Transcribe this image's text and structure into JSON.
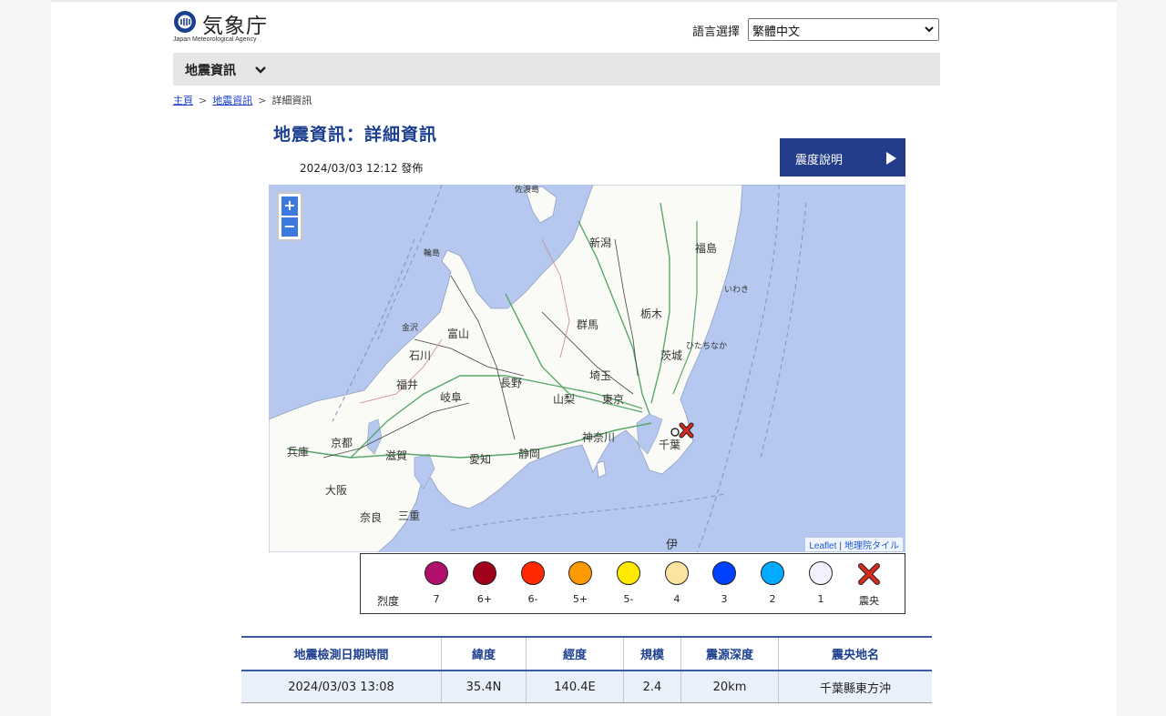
{
  "header": {
    "logo_title": "気象庁",
    "logo_subtitle": "Japan Meteorological Agency",
    "language_label": "語言選擇",
    "language_selected": "繁體中文"
  },
  "nav": {
    "menu_label": "地震資訊"
  },
  "breadcrumb": {
    "home": "主頁",
    "separator": ">",
    "earthquake": "地震資訊",
    "current": "詳細資訊"
  },
  "page": {
    "title": "地震資訊：詳細資訊",
    "issued": "2024/03/03 12:12 發佈",
    "intensity_button": "震度說明"
  },
  "map": {
    "zoom_in": "+",
    "zoom_out": "−",
    "attribution_leaflet": "Leaflet",
    "attribution_separator": "|",
    "attribution_tiles": "地理院タイル",
    "prefecture_labels": {
      "niigata": "新潟",
      "fukushima": "福島",
      "toyama": "富山",
      "ishikawa": "石川",
      "gunma": "群馬",
      "tochigi": "栃木",
      "fukui": "福井",
      "gifu": "岐阜",
      "nagano": "長野",
      "saitama": "埼玉",
      "yamanashi": "山梨",
      "tokyo": "東京",
      "kanagawa": "神奈川",
      "ibaraki": "茨城",
      "chiba": "千葉",
      "shizuoka": "静岡",
      "aichi": "愛知",
      "shiga": "滋賀",
      "kyoto": "京都",
      "hyogo": "兵庫",
      "mie": "三重",
      "nara": "奈良",
      "osaka": "大阪",
      "sado": "佐渡島",
      "wajima": "輪島",
      "kanazawa": "金沢",
      "iwaki": "いわき",
      "hitachinaka": "ひたちなか",
      "izu": "伊"
    },
    "epicenter_marker": "epicenter-x-icon"
  },
  "legend": {
    "title": "烈度",
    "items": [
      {
        "label": "7",
        "color": "#b0106c"
      },
      {
        "label": "6+",
        "color": "#a0021c"
      },
      {
        "label": "6-",
        "color": "#ff2a00"
      },
      {
        "label": "5+",
        "color": "#ff9900"
      },
      {
        "label": "5-",
        "color": "#ffea00"
      },
      {
        "label": "4",
        "color": "#fbe4a0"
      },
      {
        "label": "3",
        "color": "#0041ff"
      },
      {
        "label": "2",
        "color": "#00aaff"
      },
      {
        "label": "1",
        "color": "#f2f2ff"
      },
      {
        "label": "震央",
        "color": "#d92a1a"
      }
    ]
  },
  "quake_table": {
    "headers": [
      "地震檢測日期時間",
      "緯度",
      "經度",
      "規模",
      "震源深度",
      "震央地名"
    ],
    "rows": [
      [
        "2024/03/03 13:08",
        "35.4N",
        "140.4E",
        "2.4",
        "20km",
        "千葉縣東方沖"
      ]
    ]
  }
}
